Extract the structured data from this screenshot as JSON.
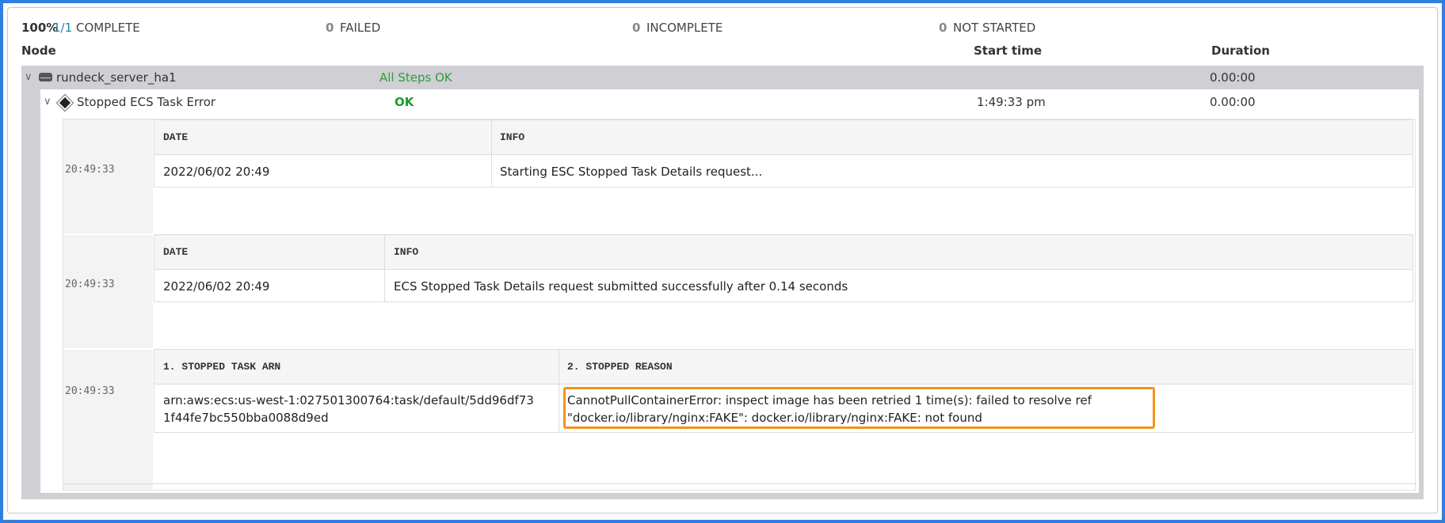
{
  "summary": {
    "percent": "100%",
    "fraction": "1/1",
    "complete_label": "COMPLETE",
    "failed_count": "0",
    "failed_label": "FAILED",
    "incomplete_count": "0",
    "incomplete_label": "INCOMPLETE",
    "not_started_count": "0",
    "not_started_label": "NOT STARTED"
  },
  "columns": {
    "node": "Node",
    "start_time": "Start time",
    "duration": "Duration"
  },
  "node": {
    "name": "rundeck_server_ha1",
    "status": "All Steps OK",
    "duration": "0.00:00"
  },
  "step": {
    "name": "Stopped ECS Task Error",
    "status": "OK",
    "start_time": "1:49:33 pm",
    "duration": "0.00:00"
  },
  "logs": [
    {
      "timestamp": "20:49:33",
      "headers": [
        "DATE",
        "INFO"
      ],
      "cells": [
        "2022/06/02 20:49",
        "Starting ESC Stopped Task Details request..."
      ]
    },
    {
      "timestamp": "20:49:33",
      "headers": [
        "DATE",
        "INFO"
      ],
      "cells": [
        "2022/06/02 20:49",
        "ECS Stopped Task Details request submitted successfully after 0.14 seconds"
      ]
    },
    {
      "timestamp": "20:49:33",
      "headers": [
        "1. STOPPED TASK ARN",
        "2. STOPPED REASON"
      ],
      "cells": [
        "arn:aws:ecs:us-west-1:027501300764:task/default/5dd96df731f44fe7bc550bba0088d9ed",
        "CannotPullContainerError: inspect image has been retried 1 time(s): failed to resolve ref \"docker.io/library/nginx:FAKE\": docker.io/library/nginx:FAKE: not found"
      ]
    }
  ],
  "colors": {
    "frame": "#2f7fe0",
    "highlight": "#f4931d",
    "success": "#2e9e3e",
    "link": "#1e7fa8"
  },
  "icons": {
    "node": "server-icon",
    "step": "diamond-icon",
    "expand": "chevron-down-icon"
  }
}
